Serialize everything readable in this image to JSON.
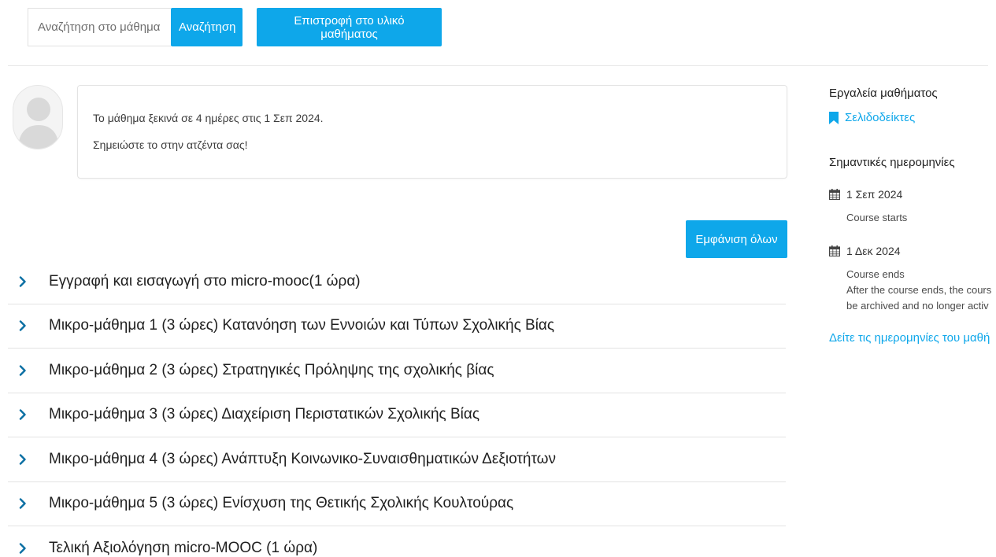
{
  "search": {
    "placeholder": "Αναζήτηση στο μάθημα",
    "button_label": "Αναζήτηση"
  },
  "return_button_label": "Επιστροφή στο υλικό μαθήματος",
  "welcome": {
    "line1": "Το μάθημα ξεκινά σε 4 ημέρες στις 1 Σεπ 2024.",
    "line2": "Σημειώστε το στην ατζέντα σας!"
  },
  "expand_all_label": "Εμφάνιση όλων",
  "sections": [
    "Εγγραφή και εισαγωγή στο micro-mooc(1 ώρα)",
    "Μικρο-μάθημα 1 (3 ώρες) Κατανόηση των Εννοιών και Τύπων Σχολικής Βίας",
    "Μικρο-μάθημα 2 (3 ώρες) Στρατηγικές Πρόληψης της σχολικής βίας",
    "Μικρο-μάθημα 3 (3 ώρες) Διαχείριση Περιστατικών Σχολικής Βίας",
    "Μικρο-μάθημα 4 (3 ώρες) Ανάπτυξη Κοινωνικο-Συναισθηματικών Δεξιοτήτων",
    "Μικρο-μάθημα 5 (3 ώρες) Ενίσχυση της Θετικής Σχολικής Κουλτούρας",
    "Τελική Αξιολόγηση micro-MOOC (1 ώρα)"
  ],
  "sidebar": {
    "tools_heading": "Εργαλεία μαθήματος",
    "bookmarks_label": "Σελιδοδείκτες",
    "dates_heading": "Σημαντικές ημερομηνίες",
    "dates": [
      {
        "date": "1 Σεπ 2024",
        "desc": [
          "Course starts"
        ]
      },
      {
        "date": "1 Δεκ 2024",
        "desc": [
          "Course ends",
          "After the course ends, the cours",
          "be archived and no longer activ"
        ]
      }
    ],
    "see_dates_label": "Δείτε τις ημερομηνίες του μαθή"
  },
  "colors": {
    "accent": "#0ea7ea",
    "divider": "#e3e3e3"
  },
  "icons": {
    "chevron": "chevron-right-icon",
    "bookmark": "bookmark-icon",
    "calendar": "calendar-icon",
    "avatar": "user-avatar-icon"
  }
}
